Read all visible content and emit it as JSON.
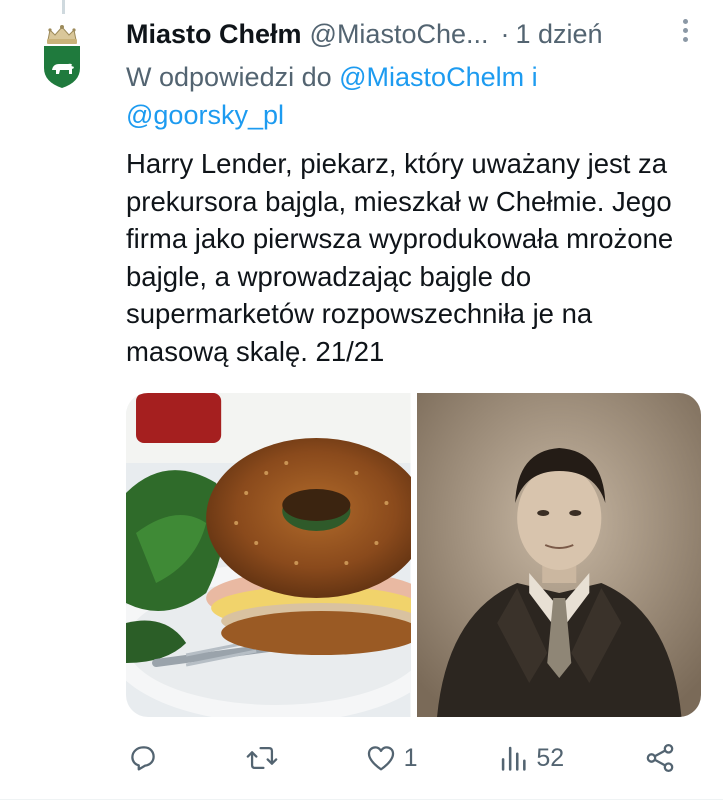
{
  "tweet": {
    "author_name": "Miasto Chełm",
    "author_handle": "@MiastoChe...",
    "separator": "·",
    "timestamp": "1 dzień",
    "reply_prefix": "W odpowiedzi do",
    "reply_mention_1": "@MiastoChelm",
    "reply_conjunction": "i",
    "reply_mention_2": "@goorsky_pl",
    "text": "Harry Lender, piekarz, który uważany jest za prekursora bajgla, mieszkał w Chełmie. Jego firma jako pierwsza wyprodukowała mrożone bajgle, a wprowadzając bajgle do supermarketów rozpowszechniła je na masową skalę. 21/21",
    "media": [
      {
        "description_icon": "bagel-sandwich-photo"
      },
      {
        "description_icon": "vintage-portrait-photo"
      }
    ]
  },
  "actions": {
    "reply_count": "",
    "retweet_count": "",
    "like_count": "1",
    "views_count": "52",
    "share_count": ""
  },
  "colors": {
    "accent": "#1d9bf0",
    "secondary_text": "#536471",
    "primary_text": "#0f1419",
    "brand_green": "#1f7a3d"
  }
}
